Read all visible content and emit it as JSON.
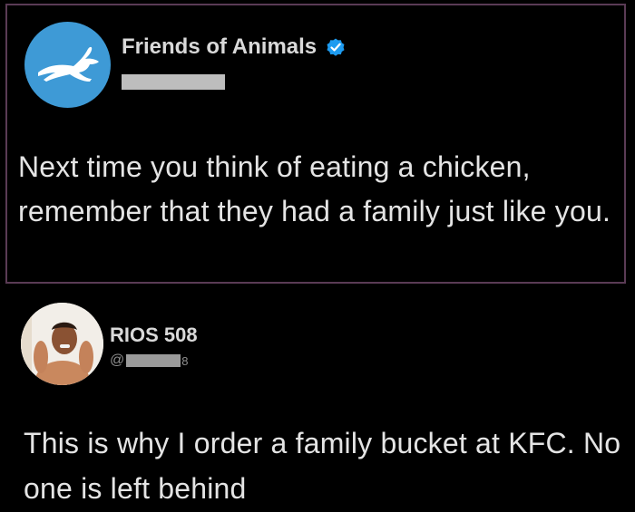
{
  "tweet1": {
    "author_name": "Friends of Animals",
    "verified_icon": "verified-badge-icon",
    "body": "Next time you think of eating a chicken, remember that they had a family  just like you."
  },
  "tweet2": {
    "author_name": "RIOS 508",
    "handle_prefix": "@",
    "handle_suffix": "8",
    "body": "This is why I order a family bucket at KFC. No one is left behind"
  },
  "colors": {
    "background": "#000000",
    "text": "#e4e4e4",
    "verified": "#1d9bf0",
    "avatar_blue": "#3e9ad6",
    "frame_border": "#5a3b55"
  }
}
